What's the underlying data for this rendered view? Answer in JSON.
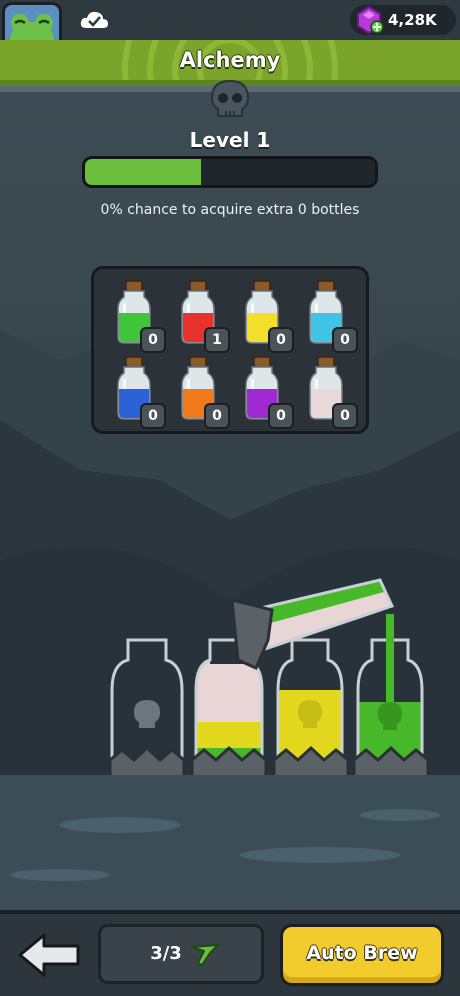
{
  "header": {
    "currency_value": "4,28K",
    "currency_icon": "gem-icon",
    "title": "Alchemy"
  },
  "level": {
    "label": "Level 1",
    "progress_fraction": 0.4
  },
  "chance_text": "0% chance to acquire extra 0 bottles",
  "potions": [
    {
      "color": "#3fc43a",
      "count": "0",
      "icon": "green-potion-icon"
    },
    {
      "color": "#e8322e",
      "count": "1",
      "icon": "red-potion-icon"
    },
    {
      "color": "#f2e02a",
      "count": "0",
      "icon": "yellow-potion-icon"
    },
    {
      "color": "#3fc4e6",
      "count": "0",
      "icon": "cyan-potion-icon"
    },
    {
      "color": "#2a62d8",
      "count": "0",
      "icon": "blue-potion-icon"
    },
    {
      "color": "#f07a1a",
      "count": "0",
      "icon": "orange-potion-icon"
    },
    {
      "color": "#a02ad2",
      "count": "0",
      "icon": "purple-potion-icon"
    },
    {
      "color": "#e8d8d8",
      "count": "0",
      "icon": "white-potion-icon"
    }
  ],
  "footer": {
    "back_icon": "back-arrow-icon",
    "bottle_count": "3/3",
    "auto_brew_label": "Auto Brew"
  },
  "colors": {
    "accent_green": "#6cbf3c",
    "button_yellow": "#f2cb2c"
  }
}
